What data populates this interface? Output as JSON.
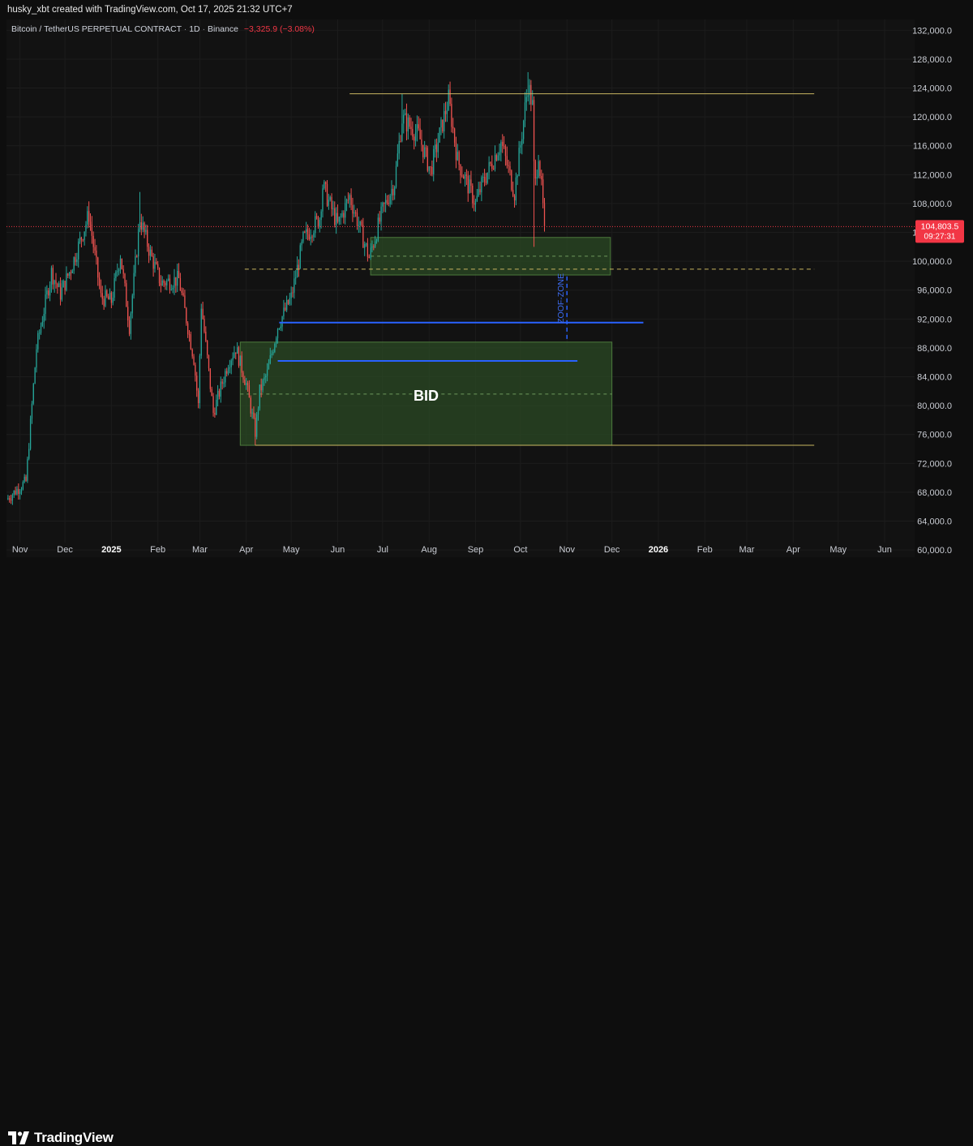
{
  "header": {
    "created_text": "husky_xbt created with TradingView.com, Oct 17, 2025 21:32 UTC+7"
  },
  "legend": {
    "symbol": "Bitcoin / TetherUS PERPETUAL CONTRACT",
    "timeframe": "1D",
    "exchange": "Binance",
    "change": "−3,325.9 (−3.08%)"
  },
  "price_tag": {
    "price": "104,803.5",
    "countdown": "09:27:31"
  },
  "annotations": {
    "bid_label": "BID",
    "zone_label": "ZOOF-ZONE"
  },
  "brand": {
    "name": "TradingView"
  },
  "colors": {
    "background": "#121212",
    "up": "#26a69a",
    "down": "#ef5350",
    "zone_fill": "#2b4a24",
    "zone_border": "#4c7a3c",
    "blue_line": "#2962ff",
    "yellow_line": "#c8b560",
    "price_line": "#f23645"
  },
  "chart_data": {
    "type": "candlestick",
    "y_ticks": [
      "132,000.0",
      "128,000.0",
      "124,000.0",
      "120,000.0",
      "116,000.0",
      "112,000.0",
      "108,000.0",
      "104,000.0",
      "100,000.0",
      "96,000.0",
      "92,000.0",
      "88,000.0",
      "84,000.0",
      "80,000.0",
      "76,000.0",
      "72,000.0",
      "68,000.0",
      "64,000.0",
      "60,000.0"
    ],
    "y_values": [
      132000,
      128000,
      124000,
      120000,
      116000,
      112000,
      108000,
      104000,
      100000,
      96000,
      92000,
      88000,
      84000,
      80000,
      76000,
      72000,
      68000,
      64000,
      60000
    ],
    "ylim": [
      59000,
      133500
    ],
    "x_ticks": [
      {
        "label": "Nov",
        "date": "2024-11-01",
        "bold": false
      },
      {
        "label": "Dec",
        "date": "2024-12-01",
        "bold": false
      },
      {
        "label": "2025",
        "date": "2025-01-01",
        "bold": true
      },
      {
        "label": "Feb",
        "date": "2025-02-01",
        "bold": false
      },
      {
        "label": "Mar",
        "date": "2025-03-01",
        "bold": false
      },
      {
        "label": "Apr",
        "date": "2025-04-01",
        "bold": false
      },
      {
        "label": "May",
        "date": "2025-05-01",
        "bold": false
      },
      {
        "label": "Jun",
        "date": "2025-06-01",
        "bold": false
      },
      {
        "label": "Jul",
        "date": "2025-07-01",
        "bold": false
      },
      {
        "label": "Aug",
        "date": "2025-08-01",
        "bold": false
      },
      {
        "label": "Sep",
        "date": "2025-09-01",
        "bold": false
      },
      {
        "label": "Oct",
        "date": "2025-10-01",
        "bold": false
      },
      {
        "label": "Nov",
        "date": "2025-11-01",
        "bold": false
      },
      {
        "label": "Dec",
        "date": "2025-12-01",
        "bold": false
      },
      {
        "label": "2026",
        "date": "2026-01-01",
        "bold": true
      },
      {
        "label": "Feb",
        "date": "2026-02-01",
        "bold": false
      },
      {
        "label": "Mar",
        "date": "2026-03-01",
        "bold": false
      },
      {
        "label": "Apr",
        "date": "2026-04-01",
        "bold": false
      },
      {
        "label": "May",
        "date": "2026-05-01",
        "bold": false
      },
      {
        "label": "Jun",
        "date": "2026-06-01",
        "bold": false
      }
    ],
    "xlim": [
      "2024-10-23",
      "2026-06-21"
    ],
    "close_path": [
      [
        "2024-10-23",
        67000
      ],
      [
        "2024-11-05",
        69500
      ],
      [
        "2024-11-12",
        88000
      ],
      [
        "2024-11-22",
        98500
      ],
      [
        "2024-11-28",
        95500
      ],
      [
        "2024-12-05",
        99000
      ],
      [
        "2024-12-17",
        106500
      ],
      [
        "2024-12-25",
        95000
      ],
      [
        "2025-01-01",
        94500
      ],
      [
        "2025-01-07",
        101000
      ],
      [
        "2025-01-13",
        91000
      ],
      [
        "2025-01-20",
        106000
      ],
      [
        "2025-01-27",
        101000
      ],
      [
        "2025-02-03",
        97000
      ],
      [
        "2025-02-15",
        97500
      ],
      [
        "2025-02-25",
        86500
      ],
      [
        "2025-02-28",
        80000
      ],
      [
        "2025-03-02",
        94000
      ],
      [
        "2025-03-10",
        79000
      ],
      [
        "2025-03-20",
        86000
      ],
      [
        "2025-03-25",
        88000
      ],
      [
        "2025-04-01",
        83000
      ],
      [
        "2025-04-07",
        76300
      ],
      [
        "2025-04-10",
        82000
      ],
      [
        "2025-04-15",
        84500
      ],
      [
        "2025-04-22",
        91000
      ],
      [
        "2025-05-01",
        95000
      ],
      [
        "2025-05-09",
        103000
      ],
      [
        "2025-05-20",
        106000
      ],
      [
        "2025-05-22",
        110500
      ],
      [
        "2025-06-01",
        105000
      ],
      [
        "2025-06-09",
        109000
      ],
      [
        "2025-06-22",
        100500
      ],
      [
        "2025-07-01",
        107000
      ],
      [
        "2025-07-09",
        111000
      ],
      [
        "2025-07-14",
        119800
      ],
      [
        "2025-07-25",
        117500
      ],
      [
        "2025-08-02",
        112500
      ],
      [
        "2025-08-14",
        122500
      ],
      [
        "2025-08-20",
        114000
      ],
      [
        "2025-09-01",
        108000
      ],
      [
        "2025-09-05",
        110500
      ],
      [
        "2025-09-18",
        116500
      ],
      [
        "2025-09-27",
        109500
      ],
      [
        "2025-10-06",
        124500
      ],
      [
        "2025-10-09",
        121500
      ],
      [
        "2025-10-10",
        113000
      ],
      [
        "2025-10-11",
        110800
      ],
      [
        "2025-10-13",
        115200
      ],
      [
        "2025-10-17",
        104803.5
      ]
    ],
    "key_highs": [
      {
        "date": "2024-12-17",
        "high": 108300
      },
      {
        "date": "2025-01-20",
        "high": 109600
      },
      {
        "date": "2025-07-14",
        "high": 123200
      },
      {
        "date": "2025-08-14",
        "high": 124500
      },
      {
        "date": "2025-10-06",
        "high": 126200
      }
    ],
    "key_lows": [
      {
        "date": "2025-04-07",
        "low": 74500
      },
      {
        "date": "2025-10-10",
        "low": 102000
      }
    ],
    "last_price": 104803.5,
    "drawings": {
      "resistance_line": {
        "y": 123200,
        "from": "2025-06-09",
        "to": "2026-04-15"
      },
      "support_line": {
        "y": 74500,
        "from": "2025-04-07",
        "to": "2026-04-15"
      },
      "upper_zone": {
        "y_top": 103300,
        "y_bottom": 98100,
        "mid": 100700,
        "from": "2025-06-23",
        "to": "2025-11-30"
      },
      "upper_zone_dashed": {
        "y": 98900,
        "from": "2025-03-31",
        "to": "2026-04-15"
      },
      "bid_zone": {
        "y_top": 88800,
        "y_bottom": 74500,
        "mid": 81600,
        "from": "2025-03-28",
        "to": "2025-12-01"
      },
      "blue_line_upper": {
        "y": 91500,
        "from": "2025-04-23",
        "to": "2025-12-22"
      },
      "blue_line_lower": {
        "y": 86200,
        "from": "2025-04-22",
        "to": "2025-11-08"
      },
      "zoof_zone_arrow": {
        "date": "2025-11-01",
        "y_from": 97900,
        "y_to": 88800
      }
    }
  }
}
